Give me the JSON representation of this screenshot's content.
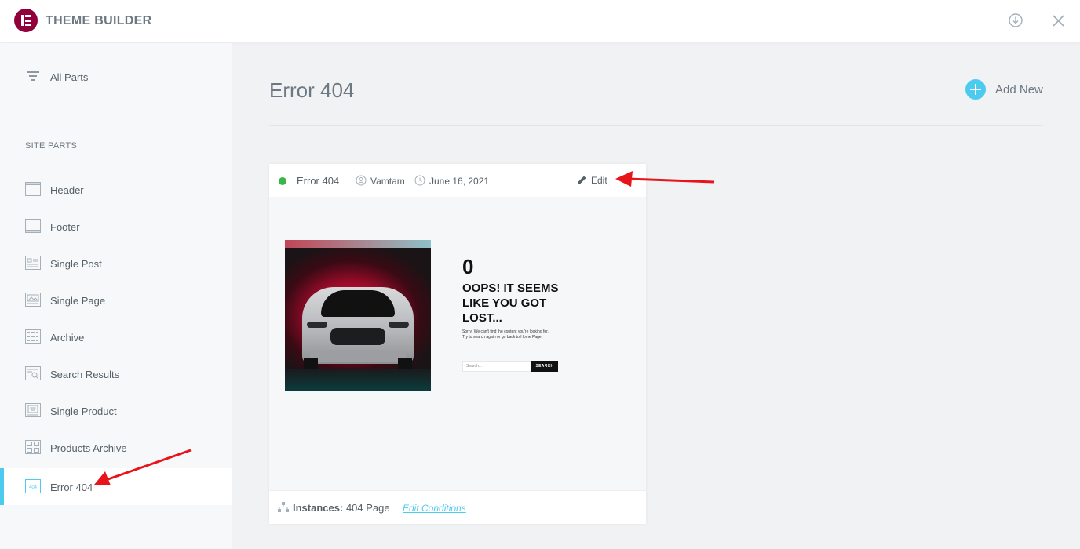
{
  "app": {
    "title": "THEME BUILDER"
  },
  "sidebar": {
    "all_parts_label": "All Parts",
    "section_label": "SITE PARTS",
    "items": [
      {
        "label": "Header",
        "icon": "header-icon"
      },
      {
        "label": "Footer",
        "icon": "footer-icon"
      },
      {
        "label": "Single Post",
        "icon": "single-post-icon"
      },
      {
        "label": "Single Page",
        "icon": "single-page-icon"
      },
      {
        "label": "Archive",
        "icon": "archive-icon"
      },
      {
        "label": "Search Results",
        "icon": "search-results-icon"
      },
      {
        "label": "Single Product",
        "icon": "single-product-icon"
      },
      {
        "label": "Products Archive",
        "icon": "products-archive-icon"
      },
      {
        "label": "Error 404",
        "icon": "error-404-icon",
        "active": true
      }
    ]
  },
  "main": {
    "title": "Error 404",
    "add_new_label": "Add New"
  },
  "card": {
    "title": "Error 404",
    "status_color": "#39b54a",
    "author": "Vamtam",
    "date": "June 16, 2021",
    "edit_label": "Edit",
    "preview": {
      "big": "0",
      "heading": "OOPS! IT SEEMS LIKE YOU GOT LOST...",
      "text_line1": "Sorry! We can't find the content you're looking for.",
      "text_line2": "Try to search again or go back to Home Page",
      "search_placeholder": "Search...",
      "search_button": "SEARCH"
    },
    "instances_label": "Instances:",
    "instances_value": "404 Page",
    "edit_conditions_label": "Edit Conditions"
  },
  "icon_404_text": "404",
  "colors": {
    "accent": "#4dcbef",
    "brand": "#92003b",
    "annotation": "#e8141c"
  }
}
